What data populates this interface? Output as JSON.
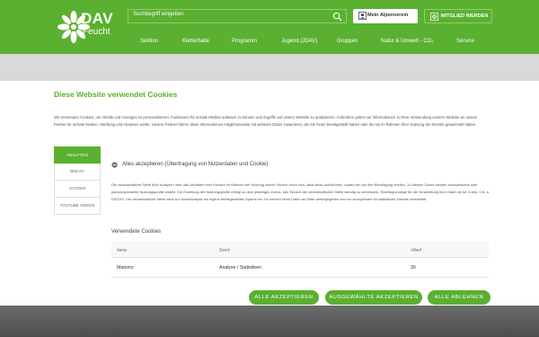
{
  "header": {
    "logo_title": "DAV",
    "logo_subtitle": "Feucht",
    "search_placeholder": "Suchbegriff eingeben",
    "my_alpenverein": "Mein Alpenverein",
    "become_member": "MITGLIED WERDEN",
    "nav": [
      "Sektion",
      "Kletterhalle",
      "Programm",
      "Jugend (JDAV)",
      "Gruppen",
      "Natur & Umwelt - CO₂",
      "Service"
    ],
    "brand_color": "#5ab030"
  },
  "modal": {
    "title": "Diese Website verwendet Cookies",
    "intro": "Wir verwenden Cookies, um Inhalte und Anzeigen zu personalisieren, Funktionen für soziale Medien anbieten zu können und Zugriffe auf unsere Website zu analysieren. Außerdem geben wir Informationen zu Ihrer Verwendung unserer Website an unsere Partner für soziale Medien, Werbung und Analysen weiter. Unsere Partner führen diese Informationen möglicherweise mit weiteren Daten zusammen, die Sie ihnen bereitgestellt haben oder die sie im Rahmen Ihrer Nutzung der Dienste gesammelt haben.",
    "tabs": [
      "ANALYTICS",
      "BREVO",
      "SYSTEM",
      "YOUTUBE VIDEOS"
    ],
    "active_tab": "ANALYTICS",
    "accept_all_label": "Alles akzeptieren (Übertragung von Nutzerdaten und Cookie)",
    "description": "Die verantwortliche Stelle führt Analysen über das Verhalten ihrer Kunden im Rahmen der Nutzung seines Service durch bzw. lässt diese durchführen, soweit sie uns ihre Einwilligung erteilen. Zu diesem Zweck werden anonymisierte oder pseudonymisierte Nutzungsprofile erstellt. Die Erstellung der Nutzungsprofile erfolgt zu dem jeweiligen Zweck, den Service der verantwortlichen Stelle ständig zu verbessern. Rechtsgrundlage für die Verarbeitung Ihrer Daten ist Art. 6 Abs. 1 lit. a DSGVO. Die verantwortliche Stelle setzt zur Nutzeranalyse ein eigens bereitgestelltes System ein. Es werden keine Daten an Dritte weitergegeben und nur anonymisiert für statistische Zwecke verarbeitet.",
    "used_cookies_title": "Verwendete Cookies",
    "table": {
      "headers": [
        "Name",
        "Zweck",
        "Ablauf"
      ],
      "rows": [
        [
          "Matomo",
          "Analyse / Statistiken",
          "30"
        ]
      ]
    },
    "buttons": {
      "accept_all": "ALLE AKZEPTIEREN",
      "accept_selected": "AUSGEWÄHLTE AKZEPTIEREN",
      "reject_all": "ALLE ABLEHNEN"
    }
  }
}
